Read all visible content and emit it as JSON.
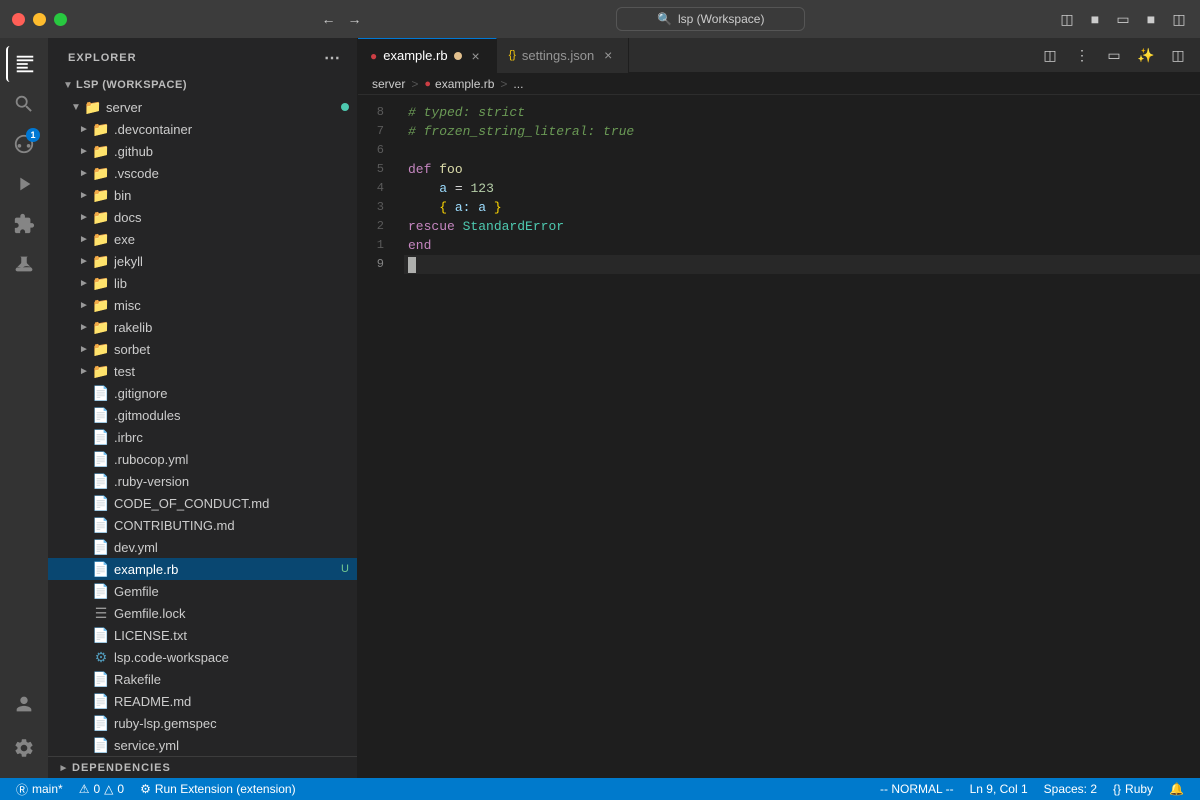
{
  "titlebar": {
    "search_text": "lsp (Workspace)",
    "nav_back": "←",
    "nav_forward": "→"
  },
  "sidebar": {
    "title": "Explorer",
    "workspace_name": "LSP (WORKSPACE)",
    "tree": {
      "server_folder": "server",
      "items": [
        {
          "name": ".devcontainer",
          "type": "folder",
          "indent": 3
        },
        {
          "name": ".github",
          "type": "folder",
          "indent": 3
        },
        {
          "name": ".vscode",
          "type": "folder",
          "indent": 3
        },
        {
          "name": "bin",
          "type": "folder",
          "indent": 3
        },
        {
          "name": "docs",
          "type": "folder",
          "indent": 3
        },
        {
          "name": "exe",
          "type": "folder",
          "indent": 3
        },
        {
          "name": "jekyll",
          "type": "folder",
          "indent": 3
        },
        {
          "name": "lib",
          "type": "folder",
          "indent": 3
        },
        {
          "name": "misc",
          "type": "folder",
          "indent": 3
        },
        {
          "name": "rakelib",
          "type": "folder",
          "indent": 3
        },
        {
          "name": "sorbet",
          "type": "folder",
          "indent": 3
        },
        {
          "name": "test",
          "type": "folder",
          "indent": 3
        },
        {
          "name": ".gitignore",
          "type": "file-git",
          "indent": 3
        },
        {
          "name": ".gitmodules",
          "type": "file-git",
          "indent": 3
        },
        {
          "name": ".irbrc",
          "type": "file-rb",
          "indent": 3
        },
        {
          "name": ".rubocop.yml",
          "type": "file-yml",
          "indent": 3
        },
        {
          "name": ".ruby-version",
          "type": "file-lock",
          "indent": 3
        },
        {
          "name": "CODE_OF_CONDUCT.md",
          "type": "file-md",
          "indent": 3
        },
        {
          "name": "CONTRIBUTING.md",
          "type": "file-md",
          "indent": 3
        },
        {
          "name": "dev.yml",
          "type": "file-yml",
          "indent": 3
        },
        {
          "name": "example.rb",
          "type": "file-rb",
          "indent": 3,
          "badge": "U",
          "active": true
        },
        {
          "name": "Gemfile",
          "type": "file-gem",
          "indent": 3
        },
        {
          "name": "Gemfile.lock",
          "type": "file-lock",
          "indent": 3
        },
        {
          "name": "LICENSE.txt",
          "type": "file-txt",
          "indent": 3
        },
        {
          "name": "lsp.code-workspace",
          "type": "file-ws",
          "indent": 3
        },
        {
          "name": "Rakefile",
          "type": "file-rake",
          "indent": 3
        },
        {
          "name": "README.md",
          "type": "file-md",
          "indent": 3
        },
        {
          "name": "ruby-lsp.gemspec",
          "type": "file-rb",
          "indent": 3
        },
        {
          "name": "service.yml",
          "type": "file-yml",
          "indent": 3
        }
      ]
    },
    "dependencies_label": "DEPENDENCIES"
  },
  "tabs": [
    {
      "label": "example.rb",
      "type": "rb",
      "modified": true,
      "active": true
    },
    {
      "label": "settings.json",
      "type": "json",
      "modified": false,
      "active": false
    }
  ],
  "breadcrumb": {
    "parts": [
      "server",
      "example.rb",
      "..."
    ]
  },
  "editor": {
    "lines": [
      {
        "num": "8",
        "content": "comment",
        "text": "# typed: strict"
      },
      {
        "num": "7",
        "content": "comment",
        "text": "# frozen_string_literal: true"
      },
      {
        "num": "6",
        "content": "empty",
        "text": ""
      },
      {
        "num": "5",
        "content": "def_foo",
        "text": ""
      },
      {
        "num": "4",
        "content": "assign",
        "text": ""
      },
      {
        "num": "3",
        "content": "hash",
        "text": ""
      },
      {
        "num": "2",
        "content": "rescue",
        "text": ""
      },
      {
        "num": "1",
        "content": "end",
        "text": ""
      },
      {
        "num": "9",
        "content": "cursor",
        "text": ""
      }
    ]
  },
  "statusbar": {
    "branch": "main*",
    "errors": "0",
    "warnings": "0",
    "run_label": "Run Extension (extension)",
    "vim_mode": "-- NORMAL --",
    "ln": "Ln 9, Col 1",
    "spaces": "Spaces: 2",
    "braces": "{}",
    "language": "Ruby",
    "encoding_icon": "🔒",
    "bell_icon": "🔔"
  }
}
